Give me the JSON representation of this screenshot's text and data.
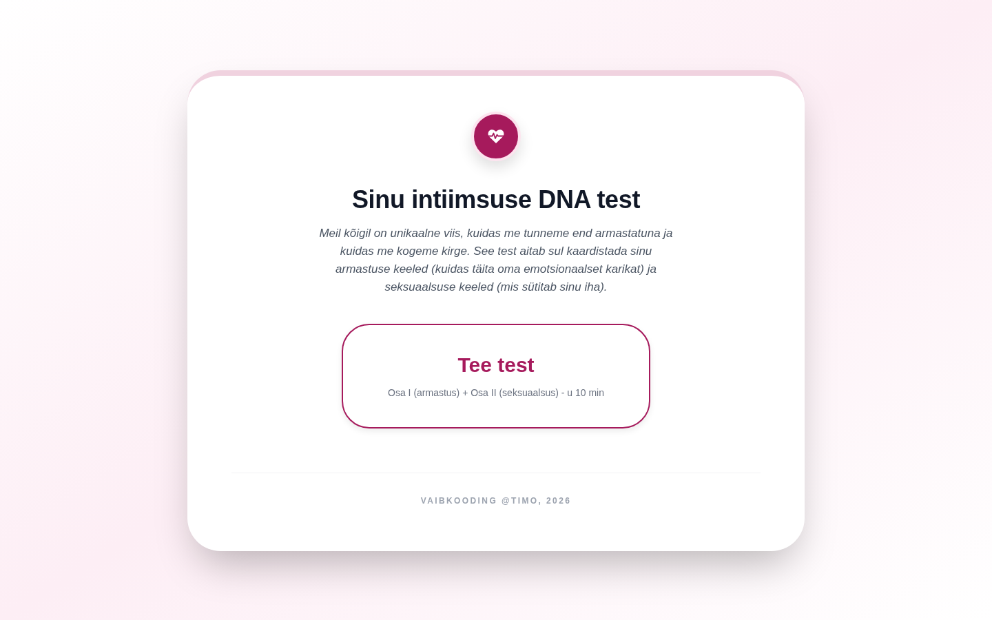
{
  "card": {
    "title": "Sinu intiimsuse DNA test",
    "description": "Meil kõigil on unikaalne viis, kuidas me tunneme end armastatuna ja kuidas me kogeme kirge. See test aitab sul kaardistada sinu armastuse keeled (kuidas täita oma emotsionaalset karikat) ja seksuaalsuse keeled (mis sütitab sinu iha).",
    "start_button": {
      "label": "Tee test",
      "details": "Osa I (armastus) + Osa II (seksuaalsus) - u 10 min"
    },
    "footer": "VAIBKOODING @TIMO, 2026"
  }
}
